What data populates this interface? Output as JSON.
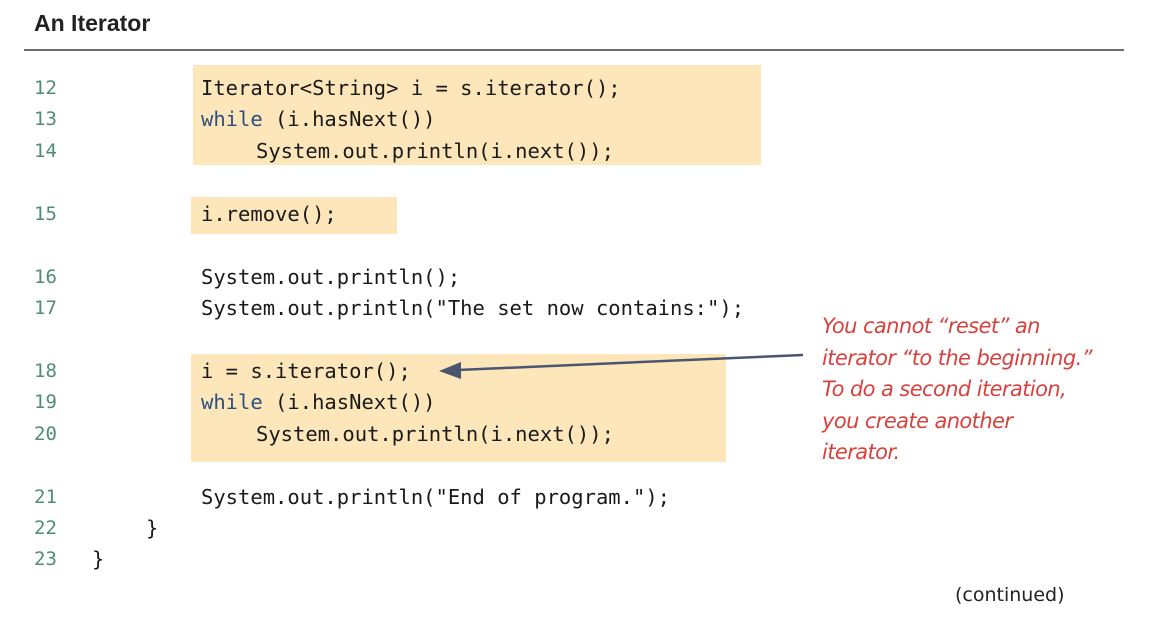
{
  "title": "An Iterator",
  "code_lines": [
    {
      "number": "12",
      "text": "Iterator<String> i = s.iterator();"
    },
    {
      "number": "13",
      "keyword": "while",
      "rest": " (i.hasNext())"
    },
    {
      "number": "14",
      "text": "System.out.println(i.next());"
    },
    {
      "number": "15",
      "text": "i.remove();"
    },
    {
      "number": "16",
      "text": "System.out.println();"
    },
    {
      "number": "17",
      "text": "System.out.println(\"The set now contains:\");"
    },
    {
      "number": "18",
      "text": "i = s.iterator();"
    },
    {
      "number": "19",
      "keyword": "while",
      "rest": " (i.hasNext())"
    },
    {
      "number": "20",
      "text": "System.out.println(i.next());"
    },
    {
      "number": "21",
      "text": "System.out.println(\"End of program.\");"
    },
    {
      "number": "22",
      "text": "}"
    },
    {
      "number": "23",
      "text": "}"
    }
  ],
  "annotation": {
    "lines": [
      "You cannot “reset” an",
      "iterator “to the beginning.”",
      "To do a second iteration,",
      "you create another",
      "iterator."
    ]
  },
  "footer": "(continued)",
  "colors": {
    "highlight": "#fce6ba",
    "line_numbers": "#4f8c77",
    "keyword": "#2f4f7f",
    "annotation": "#d6433f",
    "arrow": "#4a5670"
  }
}
